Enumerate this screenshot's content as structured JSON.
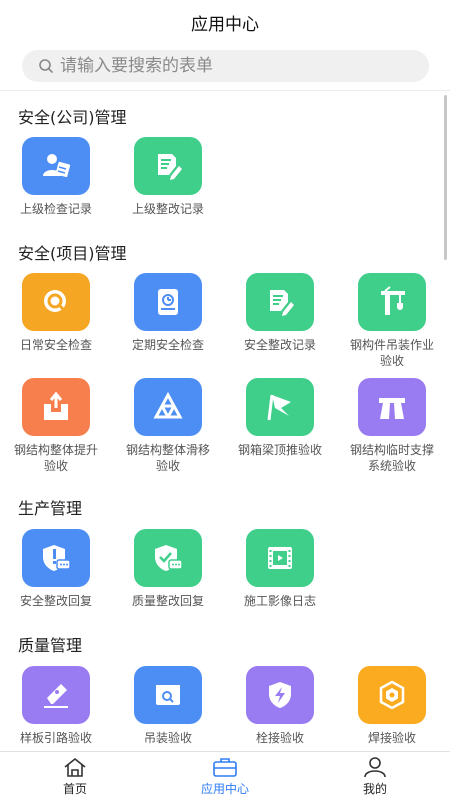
{
  "header": {
    "title": "应用中心"
  },
  "search": {
    "placeholder": "请输入要搜索的表单"
  },
  "sections": [
    {
      "title": "安全(公司)管理",
      "items": [
        {
          "label": "上级检查记录",
          "icon": "inspector-icon",
          "color": "#4d8ef5"
        },
        {
          "label": "上级整改记录",
          "icon": "edit-doc-icon",
          "color": "#3fcf8b"
        }
      ]
    },
    {
      "title": "安全(项目)管理",
      "items": [
        {
          "label": "日常安全检查",
          "icon": "magnifier-icon",
          "color": "#f5a623"
        },
        {
          "label": "定期安全检查",
          "icon": "clock-book-icon",
          "color": "#4d8ef5"
        },
        {
          "label": "安全整改记录",
          "icon": "edit-doc-icon",
          "color": "#3fcf8b"
        },
        {
          "label": "钢构件吊装作业验收",
          "icon": "crane-icon",
          "color": "#3fcf8b"
        },
        {
          "label": "钢结构整体提升验收",
          "icon": "lift-box-icon",
          "color": "#f77f4d"
        },
        {
          "label": "钢结构整体滑移验收",
          "icon": "truss-icon",
          "color": "#4d8ef5"
        },
        {
          "label": "钢箱梁顶推验收",
          "icon": "flag-icon",
          "color": "#3fcf8b"
        },
        {
          "label": "钢结构临时支撑系统验收",
          "icon": "road-icon",
          "color": "#9a7cf2"
        }
      ]
    },
    {
      "title": "生产管理",
      "items": [
        {
          "label": "安全整改回复",
          "icon": "shield-chat-icon",
          "color": "#4d8ef5"
        },
        {
          "label": "质量整改回复",
          "icon": "shield-chat-icon",
          "color": "#3fcf8b"
        },
        {
          "label": "施工影像日志",
          "icon": "film-icon",
          "color": "#3fcf8b"
        }
      ]
    },
    {
      "title": "质量管理",
      "items": [
        {
          "label": "样板引路验收",
          "icon": "pen-icon",
          "color": "#9a7cf2"
        },
        {
          "label": "吊装验收",
          "icon": "box-search-icon",
          "color": "#4d8ef5"
        },
        {
          "label": "栓接验收",
          "icon": "bolt-shield-icon",
          "color": "#9a7cf2"
        },
        {
          "label": "焊接验收",
          "icon": "hex-icon",
          "color": "#fbab1f"
        }
      ]
    }
  ],
  "tabbar": [
    {
      "label": "首页",
      "icon": "home-icon",
      "active": false
    },
    {
      "label": "应用中心",
      "icon": "briefcase-icon",
      "active": true
    },
    {
      "label": "我的",
      "icon": "user-icon",
      "active": false
    }
  ],
  "colors": {
    "accent": "#2f7df6"
  }
}
